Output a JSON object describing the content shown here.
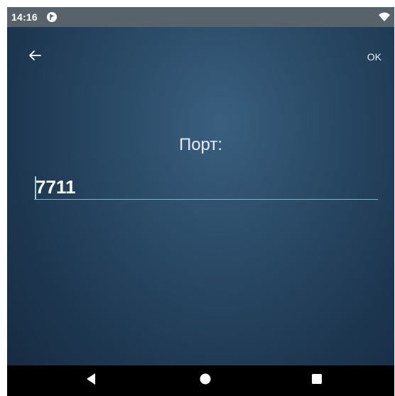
{
  "status_bar": {
    "time": "14:16",
    "app_icon": "app-notification-icon",
    "wifi_icon": "wifi-icon"
  },
  "toolbar": {
    "back_icon": "arrow-back-icon",
    "ok_label": "OK"
  },
  "form": {
    "label": "Порт:",
    "port_value": "7711"
  },
  "nav_bar": {
    "back_icon": "nav-back-icon",
    "home_icon": "nav-home-icon",
    "recents_icon": "nav-recents-icon"
  },
  "colors": {
    "status_bar": "#58626b",
    "background_center": "#3a5f7f",
    "background_edge": "#16293e",
    "underline": "#7fb3c6",
    "nav_bar": "#000000"
  }
}
